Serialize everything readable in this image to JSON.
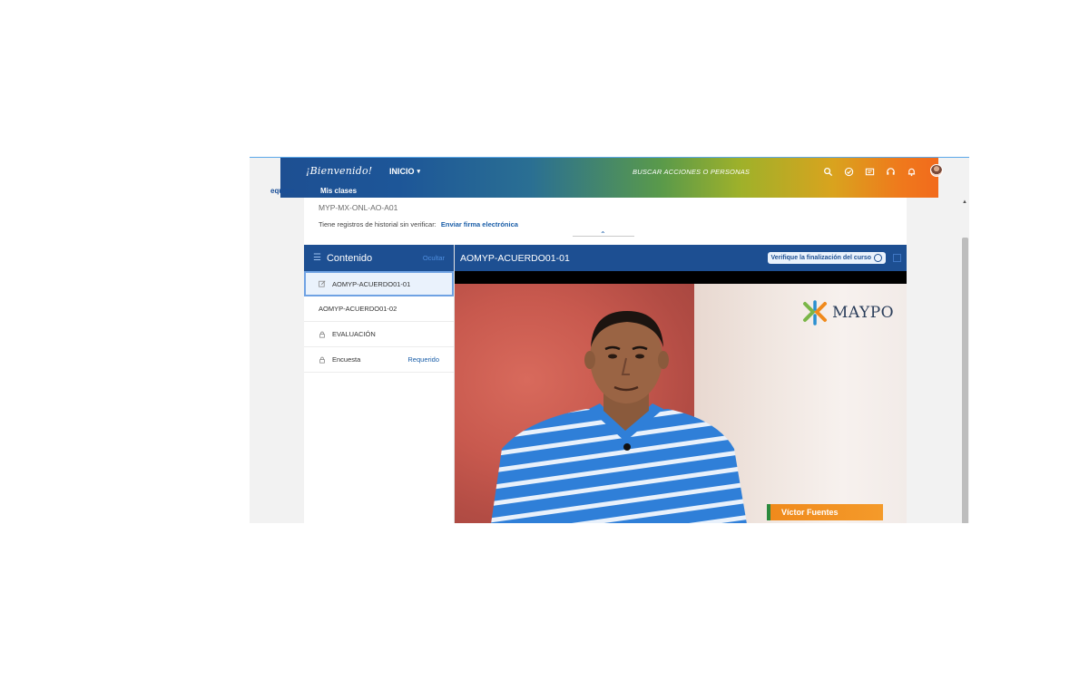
{
  "header": {
    "welcome": "¡Bienvenido!",
    "inicio_label": "INICIO",
    "search_label": "BUSCAR ACCIONES O PERSONAS",
    "icons": [
      "search-icon",
      "check-circle-icon",
      "inbox-icon",
      "headset-icon",
      "bell-icon"
    ]
  },
  "nav": {
    "equipo": "equipo",
    "mis_clases": "Mis clases"
  },
  "course": {
    "code": "MYP-MX-ONL-AO-A01",
    "history_text": "Tiene registros de historial sin verificar:",
    "history_link": "Enviar firma electrónica"
  },
  "sidebar": {
    "title": "Contenido",
    "hide_label": "Ocultar",
    "items": [
      {
        "label": "AOMYP-ACUERDO01-01",
        "icon": "edit-icon",
        "active": true,
        "tag": ""
      },
      {
        "label": "AOMYP-ACUERDO01-02",
        "icon": "",
        "active": false,
        "tag": ""
      },
      {
        "label": "EVALUACIÓN",
        "icon": "lock-icon",
        "active": false,
        "tag": ""
      },
      {
        "label": "Encuesta",
        "icon": "lock-icon",
        "active": false,
        "tag": "Requerido"
      }
    ]
  },
  "player": {
    "title": "AOMYP-ACUERDO01-01",
    "verify_label": "Verifique la finalización del curso",
    "brand": "MAYPO",
    "presenter": "Víctor Fuentes"
  }
}
